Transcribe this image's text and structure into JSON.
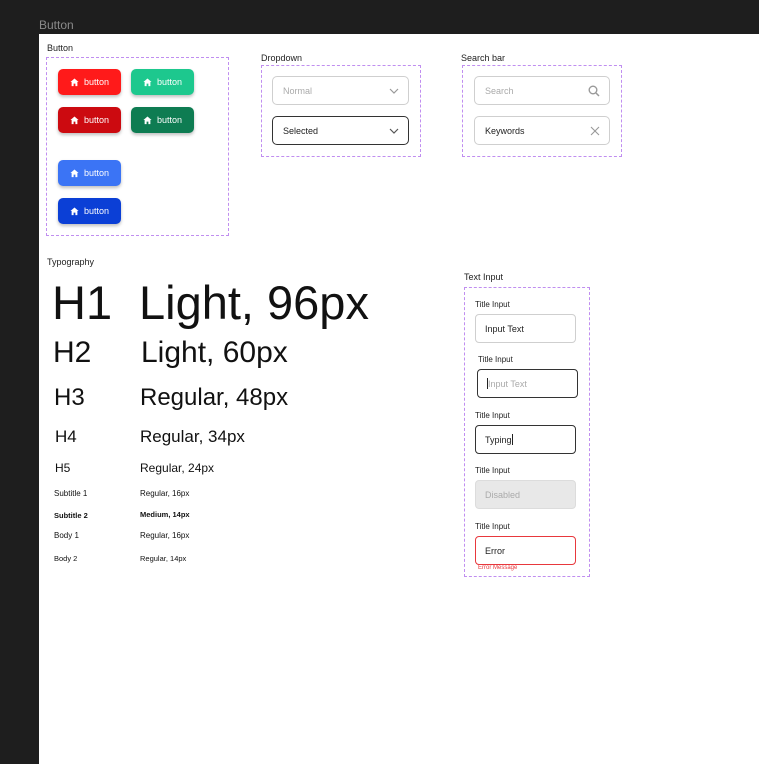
{
  "frame": {
    "title": "Button"
  },
  "buttons": {
    "label": "Button",
    "items": [
      {
        "text": "button",
        "color": "#ff1a1a"
      },
      {
        "text": "button",
        "color": "#1dc88e"
      },
      {
        "text": "button",
        "color": "#cc0a10"
      },
      {
        "text": "button",
        "color": "#0e7c52"
      },
      {
        "text": "button",
        "color": "#3b74f5"
      },
      {
        "text": "button",
        "color": "#0b3fd6"
      }
    ]
  },
  "dropdown": {
    "label": "Dropdown",
    "normal": "Normal",
    "selected": "Selected"
  },
  "search": {
    "label": "Search bar",
    "placeholder": "Search",
    "value": "Keywords"
  },
  "typography": {
    "label": "Typography",
    "rows": [
      {
        "tag": "H1",
        "desc": "Light, 96px"
      },
      {
        "tag": "H2",
        "desc": "Light, 60px"
      },
      {
        "tag": "H3",
        "desc": "Regular, 48px"
      },
      {
        "tag": "H4",
        "desc": "Regular, 34px"
      },
      {
        "tag": "H5",
        "desc": "Regular, 24px"
      },
      {
        "tag": "Subtitle 1",
        "desc": "Regular, 16px"
      },
      {
        "tag": "Subtitle 2",
        "desc": "Medium, 14px"
      },
      {
        "tag": "Body 1",
        "desc": "Regular, 16px"
      },
      {
        "tag": "Body 2",
        "desc": "Regular, 14px"
      }
    ]
  },
  "text_input": {
    "label": "Text Input",
    "fields": [
      {
        "title": "Title Input",
        "value": "Input Text",
        "state": "normal"
      },
      {
        "title": "Title Input",
        "value": "Input Text",
        "state": "focus"
      },
      {
        "title": "Title Input",
        "value": "Typing",
        "state": "typing"
      },
      {
        "title": "Title Input",
        "value": "Disabled",
        "state": "disabled"
      },
      {
        "title": "Title Input",
        "value": "Error",
        "state": "error"
      }
    ],
    "error_message": "Error Message"
  }
}
